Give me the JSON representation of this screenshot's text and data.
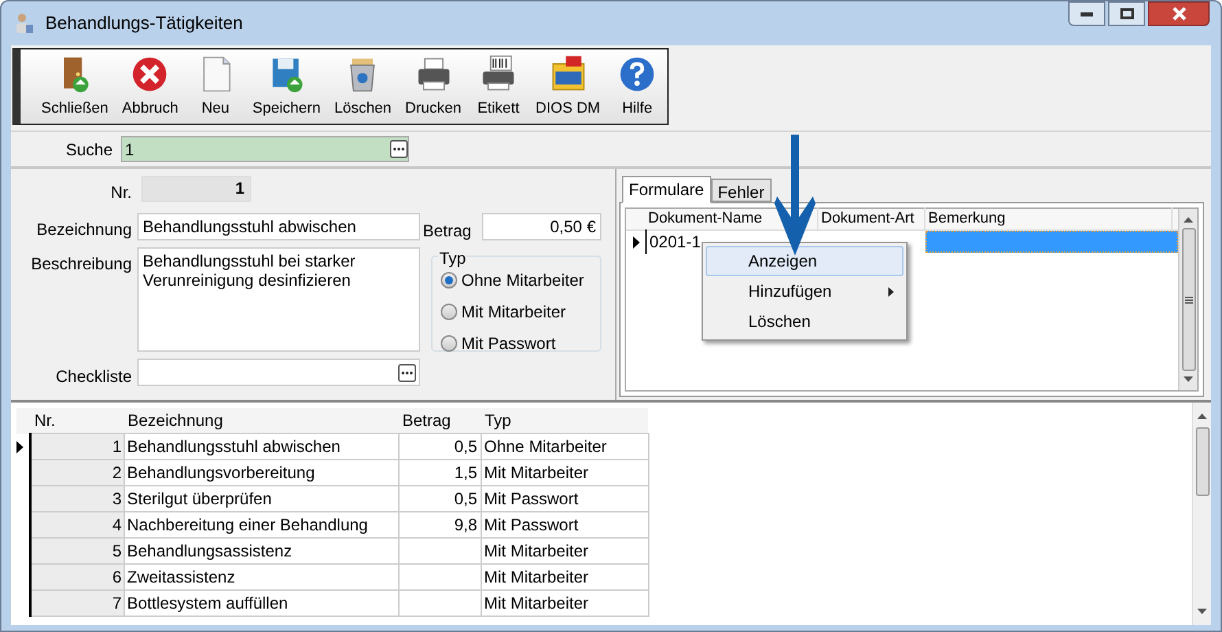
{
  "window": {
    "title": "Behandlungs-Tätigkeiten"
  },
  "toolbar": [
    {
      "label": "Schließen",
      "kind": "door"
    },
    {
      "label": "Abbruch",
      "kind": "cancel"
    },
    {
      "label": "Neu",
      "kind": "page"
    },
    {
      "label": "Speichern",
      "kind": "save"
    },
    {
      "label": "Löschen",
      "kind": "trash"
    },
    {
      "label": "Drucken",
      "kind": "printer"
    },
    {
      "label": "Etikett",
      "kind": "label"
    },
    {
      "label": "DIOS DM",
      "kind": "dms"
    },
    {
      "label": "Hilfe",
      "kind": "help"
    }
  ],
  "search": {
    "label": "Suche",
    "value": "1"
  },
  "form": {
    "nr_label": "Nr.",
    "nr": "1",
    "name_label": "Bezeichnung",
    "name": "Behandlungsstuhl abwischen",
    "amount_label": "Betrag",
    "amount": "0,50 €",
    "desc_label": "Beschreibung",
    "desc": "Behandlungsstuhl bei starker\nVerunreinigung desinfizieren",
    "type_label": "Typ",
    "types": [
      {
        "label": "Ohne Mitarbeiter",
        "checked": true
      },
      {
        "label": "Mit Mitarbeiter",
        "checked": false
      },
      {
        "label": "Mit Passwort",
        "checked": false
      }
    ],
    "checklist_label": "Checkliste"
  },
  "tabs": [
    {
      "label": "Formulare",
      "selected": true
    },
    {
      "label": "Fehler",
      "selected": false
    }
  ],
  "documents": {
    "columns": [
      "Dokument-Name",
      "Dokument-Art",
      "Bemerkung"
    ],
    "rows": [
      {
        "name": "0201-1",
        "selected": true
      }
    ]
  },
  "context_menu": [
    {
      "label": "Anzeigen",
      "selected": true,
      "kind": "item"
    },
    {
      "label": "Hinzufügen",
      "selected": false,
      "kind": "submenu"
    },
    {
      "label": "Löschen",
      "selected": false,
      "kind": "item"
    }
  ],
  "grid": {
    "columns": [
      "Nr.",
      "Bezeichnung",
      "Betrag",
      "Typ"
    ],
    "rows": [
      {
        "nr": "1",
        "name": "Behandlungsstuhl abwischen",
        "amount": "0,5",
        "type": "Ohne Mitarbeiter",
        "selected": true
      },
      {
        "nr": "2",
        "name": "Behandlungsvorbereitung",
        "amount": "1,5",
        "type": "Mit Mitarbeiter",
        "selected": false
      },
      {
        "nr": "3",
        "name": "Sterilgut überprüfen",
        "amount": "0,5",
        "type": "Mit Passwort",
        "selected": false
      },
      {
        "nr": "4",
        "name": "Nachbereitung einer Behandlung",
        "amount": "9,8",
        "type": "Mit Passwort",
        "selected": false
      },
      {
        "nr": "5",
        "name": "Behandlungsassistenz",
        "amount": "",
        "type": "Mit Mitarbeiter",
        "selected": false
      },
      {
        "nr": "6",
        "name": "Zweitassistenz",
        "amount": "",
        "type": "Mit Mitarbeiter",
        "selected": false
      },
      {
        "nr": "7",
        "name": "Bottlesystem auffüllen",
        "amount": "",
        "type": "Mit Mitarbeiter",
        "selected": false
      }
    ]
  }
}
